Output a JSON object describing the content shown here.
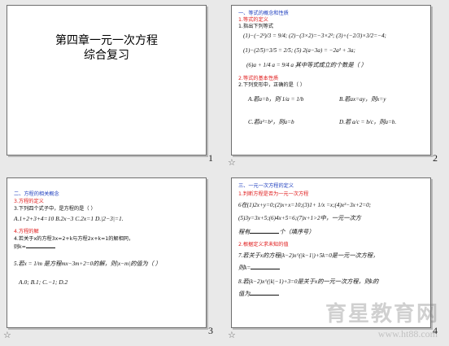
{
  "slides": [
    {
      "number": "1",
      "title_line1": "第四章一元一次方程",
      "title_line2": "综合复习"
    },
    {
      "number": "2",
      "heading": "一、等式的概念和性质",
      "sub1": "1.等式的定义",
      "item1": "1.指出下列等式",
      "eq1": "(1)−(−2²)/3 = 9/4; (2)−(3×2)=−3×2²; (3)+(−2/3)×3/2=−4;",
      "eq2": "(1)−(2/5)=3/5 = 2/5; (5) 2(a−3a) = −2a² + 3a;",
      "eq3": "(6)a + 1/4 a = 9/4 a 其中等式成立的个数是（ ）",
      "sub2": "2.等式的基本性质",
      "item2": "2.下列变形中，正确的是（ ）",
      "optA": "A.若a=b，则 1/a = 1/b",
      "optB": "B.若ax=ay，则x=y",
      "optC": "C.若a²=b²，则a=b",
      "optD": "D.若 a/c = b/c，则a=b."
    },
    {
      "number": "3",
      "heading": "二、方程的相关概念",
      "sub1": "3.方程的定义",
      "item1": "3.下列四个式子中，是方程的是（ ）",
      "opts": "A.1+2+3+4=10    B.2x−3    C.2x=1    D.|2−3|=1.",
      "sub2": "4.方程的解",
      "item2": "4.若关于x的方程3x=2+k与方程2x+k=1的解相同，",
      "item2b": "则k=",
      "item3": "5.若x = 1/m 是方程mx−3m+2=0的解，则|x−m|的值为（ ）",
      "opts2": "A.0;    B.1;    C.−1;    D.2"
    },
    {
      "number": "4",
      "heading": "三、一元一次方程的定义",
      "sub1": "1.判断方程是否为一元一次方程",
      "eq1": "6在(1)2x+y=0;(2)x+x=10;(3)1+ 1/x =x;(4)x²−3x+2=0;",
      "eq2": "(5)3y=3x+5;(6)4x+5=6;(7)x+1>2中，一元一次方",
      "eq3": "程有",
      "eq3b": "个（填序号）",
      "sub2": "2.根据定义求未知的值",
      "item1": "7.若关于x的方程(k−2)x^(|k−1|)+5k=0是一元一次方程，",
      "item1b": "则k=",
      "item2": "8.若(k−2)x^(|k|−1)+3=0是关于x的一元一次方程，则k的",
      "item2b": "值为"
    }
  ],
  "watermark": {
    "text": "育星教育网",
    "url": "www.ht88.com"
  }
}
